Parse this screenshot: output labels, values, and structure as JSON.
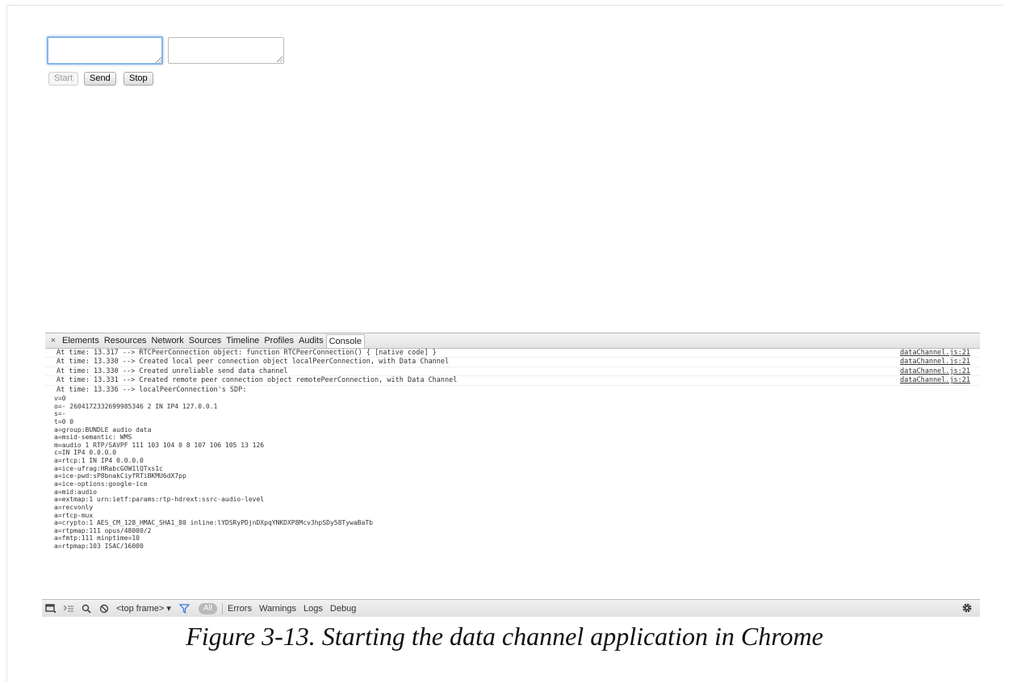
{
  "page": {
    "buttons": {
      "start": "Start",
      "send": "Send",
      "stop": "Stop"
    },
    "inputs": {
      "send_text": "",
      "receive_text": ""
    }
  },
  "devtools": {
    "close_glyph": "×",
    "tabs": [
      "Elements",
      "Resources",
      "Network",
      "Sources",
      "Timeline",
      "Profiles",
      "Audits",
      "Console"
    ],
    "active_tab": "Console",
    "log_rows": [
      {
        "text": "At time: 13.317 --> RTCPeerConnection object: function RTCPeerConnection() { [native code] }",
        "source": "dataChannel.js:21"
      },
      {
        "text": "At time: 13.330 --> Created local peer connection object localPeerConnection, with Data Channel",
        "source": "dataChannel.js:21"
      },
      {
        "text": "At time: 13.330 --> Created unreliable send data channel",
        "source": "dataChannel.js:21"
      },
      {
        "text": "At time: 13.331 --> Created remote peer connection object remotePeerConnection, with Data Channel",
        "source": "dataChannel.js:21"
      },
      {
        "text": "At time: 13.336 --> localPeerConnection's SDP:",
        "source": ""
      }
    ],
    "sdp_lines": [
      "v=0",
      "o=- 2604172332699985346 2 IN IP4 127.0.0.1",
      "s=-",
      "t=0 0",
      "a=group:BUNDLE audio data",
      "a=msid-semantic: WMS",
      "m=audio 1 RTP/SAVPF 111 103 104 0 8 107 106 105 13 126",
      "c=IN IP4 0.0.0.0",
      "a=rtcp:1 IN IP4 0.0.0.0",
      "a=ice-ufrag:HRabcGOW1lQTxs1c",
      "a=ice-pwd:sP8bnakCiyfRTiBKMU6dX7pp",
      "a=ice-options:google-ice",
      "a=mid:audio",
      "a=extmap:1 urn:ietf:params:rtp-hdrext:ssrc-audio-level",
      "a=recvonly",
      "a=rtcp-mux",
      "a=crypto:1 AES_CM_128_HMAC_SHA1_80 inline:lYDSRyPDjnDXpqYNKDXP8Mcv3hpSDy58TywaBaTb",
      "a=rtpmap:111 opus/48000/2",
      "a=fmtp:111 minptime=10",
      "a=rtpmap:103 ISAC/16000"
    ],
    "statusbar": {
      "frame_select": "<top frame> ▾",
      "filter_all": "All",
      "levels": [
        "Errors",
        "Warnings",
        "Logs",
        "Debug"
      ]
    },
    "icons": [
      "dock-icon",
      "drawer-icon",
      "search-icon",
      "clear-console-icon",
      "filter-icon",
      "gear-icon"
    ]
  },
  "caption": "Figure 3-13. Starting the data channel application in Chrome"
}
